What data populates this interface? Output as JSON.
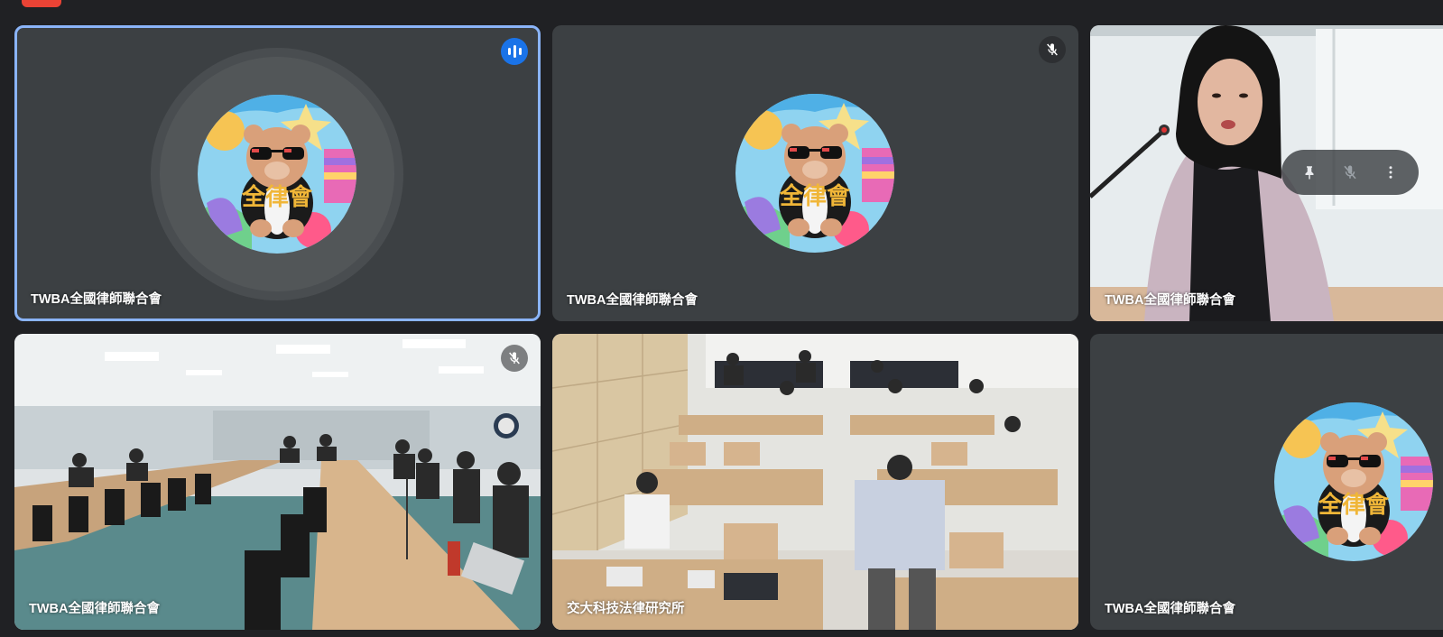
{
  "meeting": {
    "tiles": [
      {
        "name": "TWBA全國律師聯合會",
        "state": "speaking"
      },
      {
        "name": "TWBA全國律師聯合會",
        "state": "muted"
      },
      {
        "name": "TWBA全國律師聯合會",
        "state": "video"
      },
      {
        "name": "TWBA全國律師聯合會",
        "state": "muted-video"
      },
      {
        "name": "交大科技法律研究所",
        "state": "video"
      },
      {
        "name": "TWBA全國律師聯合會",
        "state": "avatar"
      }
    ],
    "avatar_text": "全律會"
  },
  "colors": {
    "background": "#202124",
    "tile": "#3c4043",
    "speaking_border": "#8ab4f8",
    "speaking_badge": "#1a73e8",
    "top_pill": "#ea4335"
  },
  "icons": {
    "speaking": "audio-level-icon",
    "muted": "mic-off-icon",
    "pin": "pin-icon",
    "more": "more-vert-icon"
  }
}
